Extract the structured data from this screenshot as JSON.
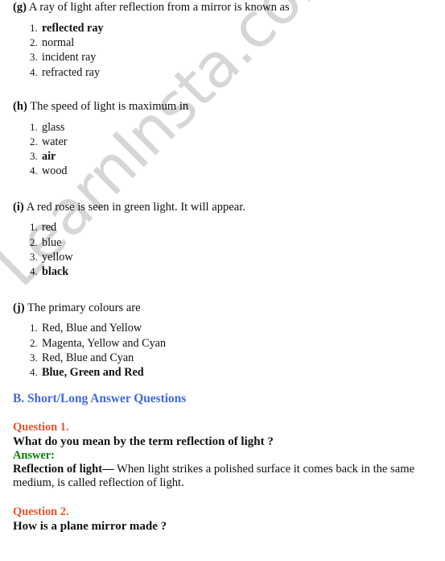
{
  "watermark": {
    "text": "LearnInsta.com",
    "color": "#d6d6d6"
  },
  "colors": {
    "section_heading": "#4169e1",
    "question_number": "#e8532b",
    "answer_label": "#008000",
    "body_text": "#111111"
  },
  "mcq": [
    {
      "label": "(g)",
      "stem": " A ray of light after reflection from a mirror is known as",
      "options": [
        {
          "num": "1.",
          "text": "reflected ray",
          "correct": true
        },
        {
          "num": "2.",
          "text": "normal",
          "correct": false
        },
        {
          "num": "3.",
          "text": "incident ray",
          "correct": false
        },
        {
          "num": "4.",
          "text": "refracted ray",
          "correct": false
        }
      ]
    },
    {
      "label": "(h)",
      "stem": " The speed of light is maximum in",
      "options": [
        {
          "num": "1.",
          "text": "glass",
          "correct": false
        },
        {
          "num": "2.",
          "text": "water",
          "correct": false
        },
        {
          "num": "3.",
          "text": "air",
          "correct": true
        },
        {
          "num": "4.",
          "text": "wood",
          "correct": false
        }
      ]
    },
    {
      "label": "(i)",
      "stem": " A red rose is seen in green light. It will appear.",
      "options": [
        {
          "num": "1.",
          "text": "red",
          "correct": false
        },
        {
          "num": "2.",
          "text": "blue",
          "correct": false
        },
        {
          "num": "3.",
          "text": "yellow",
          "correct": false
        },
        {
          "num": "4.",
          "text": "black",
          "correct": true
        }
      ]
    },
    {
      "label": "(j)",
      "stem": " The primary colours are",
      "options": [
        {
          "num": "1.",
          "text": "Red, Blue and Yellow",
          "correct": false
        },
        {
          "num": "2.",
          "text": "Magenta, Yellow and Cyan",
          "correct": false
        },
        {
          "num": "3.",
          "text": "Red, Blue and Cyan",
          "correct": false
        },
        {
          "num": "4.",
          "text": "Blue, Green and Red",
          "correct": true
        }
      ]
    }
  ],
  "section": {
    "heading": "B. Short/Long Answer Questions"
  },
  "qa": [
    {
      "number": "Question 1.",
      "question": "What do you mean by the term reflection of light ?",
      "answer_label": "Answer:",
      "answer_term": "Reflection of light—",
      "answer_body": " When light strikes a polished surface it comes back in the same medium, is called reflection of light."
    },
    {
      "number": "Question 2.",
      "question": "How is a plane mirror made ?"
    }
  ]
}
